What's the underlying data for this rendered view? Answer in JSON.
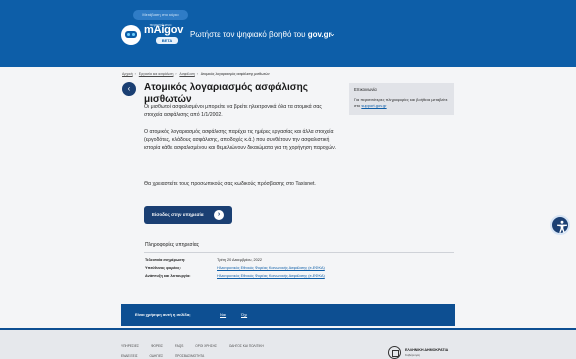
{
  "header": {
    "skip_link": "Μετάβαση στο κύριο περιεχόμενο",
    "brand": "mAigov",
    "beta": "BETA",
    "ask_prefix": "Ρωτήστε τον ψηφιακό βοηθό του ",
    "ask_site": "gov.gr"
  },
  "breadcrumb": [
    "Αρχική",
    "Εργασία και ασφάλιση",
    "Ασφάλιση",
    "Ατομικός λογαριασμός ασφάλισης μισθωτών"
  ],
  "main": {
    "title": "Ατομικός λογαριασμός ασφάλισης μισθωτών",
    "p1": "Οι μισθωτοί ασφαλισμένοι μπορείτε να βρείτε ηλεκτρονικά όλα τα ατομικά σας στοιχεία ασφάλισης από 1/1/2002.",
    "p2": "Ο ατομικός λογαριασμός ασφάλισης παρέχει τις ημέρες εργασίας και άλλα στοιχεία (εργοδότες, κλάδους ασφάλισης, αποδοχές κ.ά.) που συνθέτουν την ασφαλιστική ιστορία κάθε ασφαλισμένου και θεμελιώνουν δικαιώματα για τη χορήγηση παροχών.",
    "p3": "Θα χρειαστείτε τους προσωπικούς σας κωδικούς πρόσβασης στο Taxisnet.",
    "cta": "Είσοδος στην υπηρεσία"
  },
  "sidebar": {
    "title": "Επικοινωνία",
    "text_prefix": "Για περισσότερες πληροφορίες και βοήθεια μεταβείτε στο ",
    "link": "support.gov.gr"
  },
  "info": {
    "title": "Πληροφορίες υπηρεσίας",
    "rows": [
      {
        "key": "Τελευταία ενημέρωση:",
        "value": "Τρίτη 20 Δεκεμβρίου, 2022"
      },
      {
        "key": "Υπεύθυνος φορέας:",
        "value": "Ηλεκτρονικός Εθνικός Φορέας Κοινωνικής Ασφάλισης (e-ΕΦΚΑ)"
      },
      {
        "key": "Ανάπτυξη και λειτουργία:",
        "value": "Ηλεκτρονικός Εθνικός Φορέας Κοινωνικής Ασφάλισης (e-ΕΦΚΑ)"
      }
    ]
  },
  "feedback": {
    "question": "Είναι χρήσιμη αυτή η σελίδα;",
    "yes": "Ναι",
    "no": "Όχι"
  },
  "footer": {
    "row1": [
      "ΥΠΗΡΕΣΙΕΣ",
      "ΦΟΡΕΙΣ",
      "FAQS",
      "ΟΡΟΙ ΧΡΗΣΗΣ",
      "ΟΔΗΓΟΣ ΚΑΙ ΠΟΛΙΤΙΚΗ"
    ],
    "row2": [
      "ΕΝΔΕΙΞΕΙΣ",
      "ΟΔΗΓΙΕΣ",
      "ΠΡΟΣΒΑΣΙΜΟΤΗΤΑ"
    ],
    "gov_title": "ΕΛΛΗΝΙΚΗ ΔΗΜΟΚΡΑΤΙΑ",
    "gov_sub": "Κυβέρνηση"
  },
  "colors": {
    "header_bg": "#0d5ea8",
    "primary_dark": "#1a3f73",
    "feedback_bg": "#0d4f92",
    "page_bg": "#f4f5f7"
  }
}
